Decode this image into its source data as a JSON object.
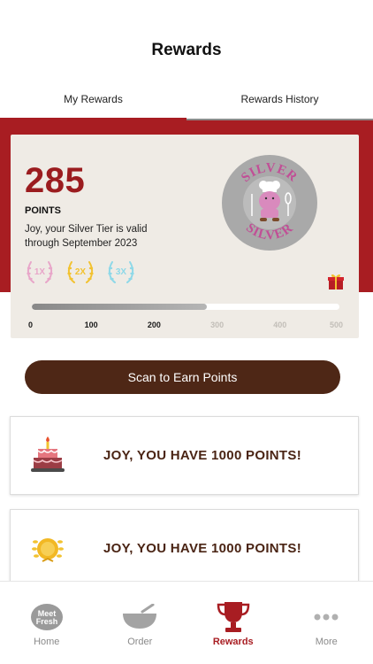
{
  "header": {
    "title": "Rewards"
  },
  "tabs": [
    {
      "label": "My Rewards",
      "active": true
    },
    {
      "label": "Rewards History",
      "active": false
    }
  ],
  "rewards_card": {
    "points": "285",
    "points_label": "POINTS",
    "tier_message": "Joy, your Silver Tier is valid through September 2023",
    "multipliers": [
      {
        "label": "1X",
        "color": "#e8a6c9"
      },
      {
        "label": "2X",
        "color": "#f2c230"
      },
      {
        "label": "3X",
        "color": "#8ed8e8"
      }
    ],
    "badge": {
      "tier_text": "SILVER",
      "icon": "chef-mascot-icon"
    },
    "gift_icon": "gift-icon",
    "progress": {
      "value": 285,
      "max": 500
    },
    "scale": [
      "0",
      "100",
      "200",
      "300",
      "400",
      "500"
    ]
  },
  "scan_button": {
    "label": "Scan to Earn Points"
  },
  "promos": [
    {
      "text": "JOY, YOU HAVE 1000 POINTS!",
      "icon": "birthday-cake-icon"
    },
    {
      "text": "JOY, YOU HAVE 1000 POINTS!",
      "icon": "gold-medal-icon"
    }
  ],
  "bottom_nav": [
    {
      "label": "Home",
      "icon": "meet-fresh-logo-icon",
      "active": false
    },
    {
      "label": "Order",
      "icon": "bowl-icon",
      "active": false
    },
    {
      "label": "Rewards",
      "icon": "trophy-icon",
      "active": true
    },
    {
      "label": "More",
      "icon": "more-dots-icon",
      "active": false
    }
  ],
  "colors": {
    "brand_red": "#a81d22",
    "brand_brown": "#4e2716",
    "card_bg": "#efebe5"
  }
}
